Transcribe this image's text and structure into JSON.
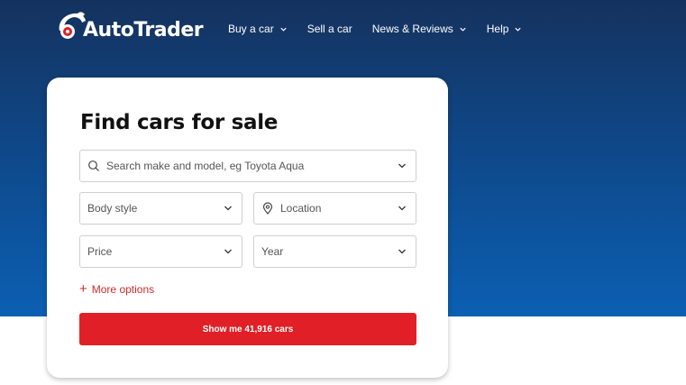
{
  "brand": {
    "name": "AutoTrader",
    "logo_icon": "autotrader-logo-icon"
  },
  "nav": {
    "items": [
      {
        "label": "Buy a car",
        "has_dropdown": true
      },
      {
        "label": "Sell a car",
        "has_dropdown": false
      },
      {
        "label": "News & Reviews",
        "has_dropdown": true
      },
      {
        "label": "Help",
        "has_dropdown": true
      }
    ]
  },
  "search_card": {
    "title": "Find cars for sale",
    "search": {
      "placeholder": "Search make and model, eg Toyota Aqua",
      "icon": "search-icon"
    },
    "body_style": {
      "label": "Body style"
    },
    "location": {
      "label": "Location",
      "icon": "location-pin-icon"
    },
    "price": {
      "label": "Price"
    },
    "year": {
      "label": "Year"
    },
    "more_options": {
      "label": "More options"
    },
    "submit": {
      "label": "Show me 41,916 cars"
    }
  },
  "colors": {
    "hero_top": "#15325e",
    "hero_bottom": "#0b5fb3",
    "accent_red": "#e02026",
    "link_red": "#d12a2a"
  }
}
